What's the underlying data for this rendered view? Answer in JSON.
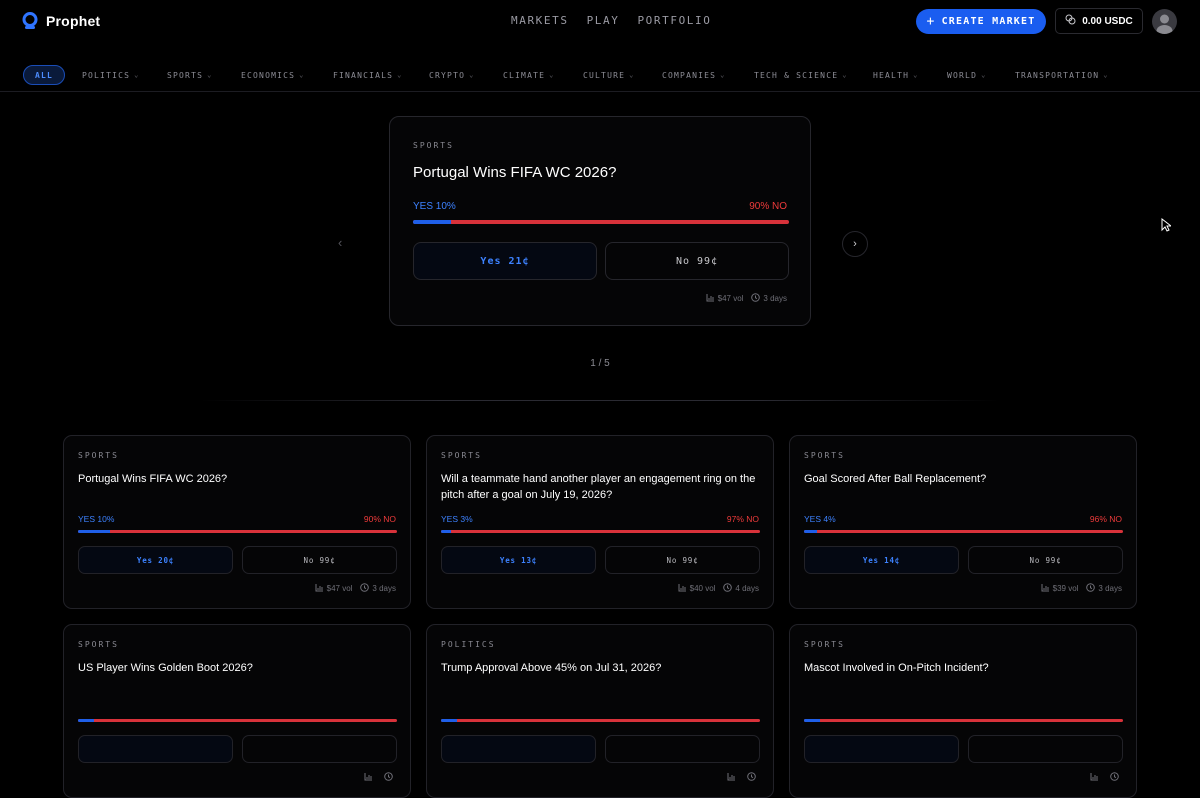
{
  "header": {
    "brand": "Prophet",
    "nav": [
      "MARKETS",
      "PLAY",
      "PORTFOLIO"
    ],
    "create_label": "CREATE MARKET",
    "balance": "0.00 USDC"
  },
  "categories": [
    {
      "label": "ALL",
      "active": true
    },
    {
      "label": "POLITICS"
    },
    {
      "label": "SPORTS"
    },
    {
      "label": "ECONOMICS"
    },
    {
      "label": "FINANCIALS"
    },
    {
      "label": "CRYPTO"
    },
    {
      "label": "CLIMATE"
    },
    {
      "label": "CULTURE"
    },
    {
      "label": "COMPANIES"
    },
    {
      "label": "TECH & SCIENCE"
    },
    {
      "label": "HEALTH"
    },
    {
      "label": "WORLD"
    },
    {
      "label": "TRANSPORTATION"
    }
  ],
  "featured": {
    "tag": "SPORTS",
    "title": "Portugal Wins FIFA WC 2026?",
    "yes_label": "YES 10%",
    "no_label": "90% NO",
    "yes_fraction": 0.1,
    "yes_button": "Yes 21¢",
    "no_button": "No 99¢",
    "volume": "$47 vol",
    "time_left": "3 days",
    "pager": "1 / 5"
  },
  "markets": [
    {
      "tag": "SPORTS",
      "title": "Portugal Wins FIFA WC 2026?",
      "yes_label": "YES 10%",
      "no_label": "90% NO",
      "yes_fraction": 0.1,
      "yes_button": "Yes 20¢",
      "no_button": "No 99¢",
      "volume": "$47 vol",
      "time_left": "3 days"
    },
    {
      "tag": "SPORTS",
      "title": "Will a teammate hand another player an engagement ring on the pitch after a goal on July 19, 2026?",
      "yes_label": "YES 3%",
      "no_label": "97% NO",
      "yes_fraction": 0.03,
      "yes_button": "Yes 13¢",
      "no_button": "No 99¢",
      "volume": "$40 vol",
      "time_left": "4 days"
    },
    {
      "tag": "SPORTS",
      "title": "Goal Scored After Ball Replacement?",
      "yes_label": "YES 4%",
      "no_label": "96% NO",
      "yes_fraction": 0.04,
      "yes_button": "Yes 14¢",
      "no_button": "No 99¢",
      "volume": "$39 vol",
      "time_left": "3 days"
    },
    {
      "tag": "SPORTS",
      "title": "US Player Wins Golden Boot 2026?",
      "yes_label": "",
      "no_label": "",
      "yes_fraction": 0.05,
      "yes_button": "",
      "no_button": "",
      "volume": "",
      "time_left": ""
    },
    {
      "tag": "POLITICS",
      "title": "Trump Approval Above 45% on Jul 31, 2026?",
      "yes_label": "",
      "no_label": "",
      "yes_fraction": 0.05,
      "yes_button": "",
      "no_button": "",
      "volume": "",
      "time_left": ""
    },
    {
      "tag": "SPORTS",
      "title": "Mascot Involved in On-Pitch Incident?",
      "yes_label": "",
      "no_label": "",
      "yes_fraction": 0.05,
      "yes_button": "",
      "no_button": "",
      "volume": "",
      "time_left": ""
    }
  ]
}
